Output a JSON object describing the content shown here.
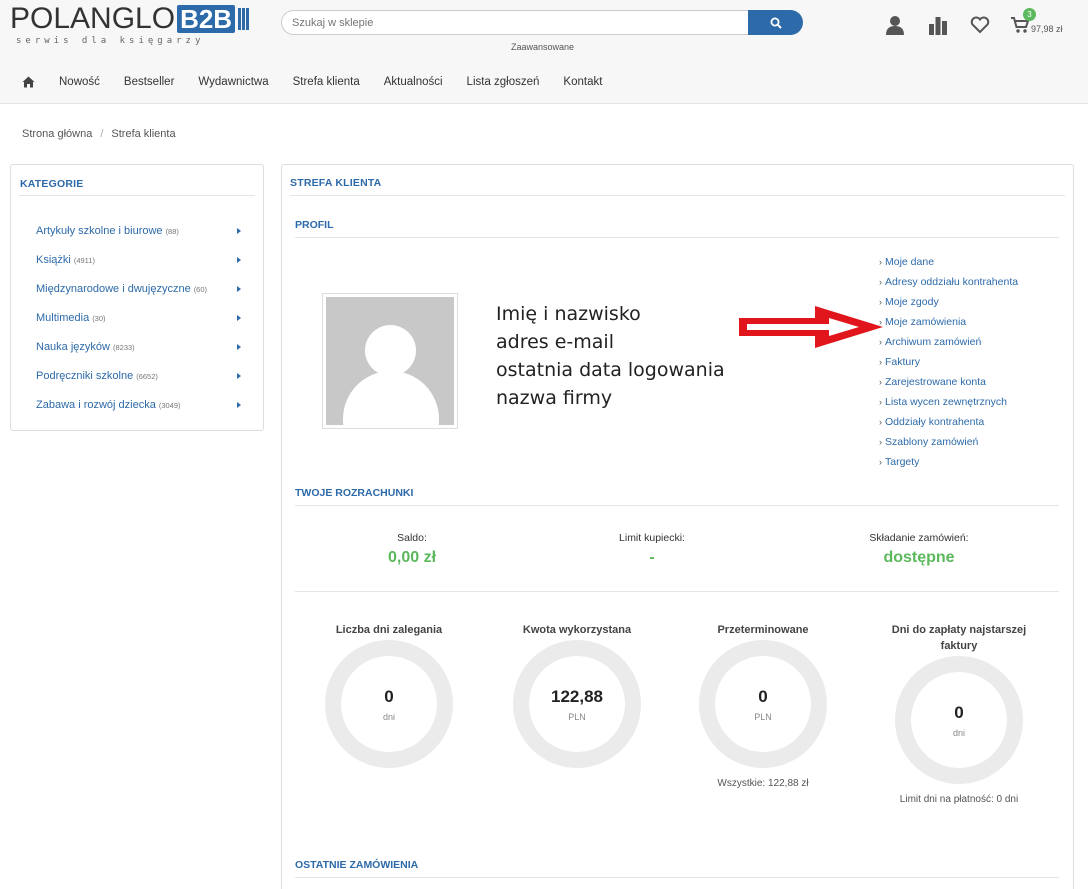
{
  "header": {
    "logo_main": "POLANGLO",
    "logo_b2b": "B2B",
    "logo_sub": "serwis dla księgarzy",
    "search_placeholder": "Szukaj w sklepie",
    "advanced": "Zaawansowane",
    "cart_count": "3",
    "cart_total": "97,98 zł"
  },
  "nav": [
    "Nowość",
    "Bestseller",
    "Wydawnictwa",
    "Strefa klienta",
    "Aktualności",
    "Lista zgłoszeń",
    "Kontakt"
  ],
  "breadcrumb": [
    "Strona główna",
    "Strefa klienta"
  ],
  "categories": {
    "title": "KATEGORIE",
    "items": [
      {
        "label": "Artykuły szkolne i biurowe",
        "count": "(88)"
      },
      {
        "label": "Książki",
        "count": "(4911)"
      },
      {
        "label": "Międzynarodowe i dwujęzyczne",
        "count": "(60)"
      },
      {
        "label": "Multimedia",
        "count": "(30)"
      },
      {
        "label": "Nauka języków",
        "count": "(8233)"
      },
      {
        "label": "Podręczniki szkolne",
        "count": "(6652)"
      },
      {
        "label": "Zabawa i rozwój dziecka",
        "count": "(3049)"
      }
    ]
  },
  "main": {
    "title": "STREFA KLIENTA",
    "profile_title": "PROFIL",
    "profile_lines": [
      "Imię i nazwisko",
      "adres e-mail",
      "ostatnia data logowania",
      "nazwa firmy"
    ],
    "links": [
      "Moje dane",
      "Adresy oddziału kontrahenta",
      "Moje zgody",
      "Moje zamówienia",
      "Archiwum zamówień",
      "Faktury",
      "Zarejestrowane konta",
      "Lista wycen zewnętrznych",
      "Oddziały kontrahenta",
      "Szablony zamówień",
      "Targety"
    ],
    "settlements_title": "TWOJE ROZRACHUNKI",
    "stats": [
      {
        "label": "Saldo:",
        "value": "0,00 zł"
      },
      {
        "label": "Limit kupiecki:",
        "value": "-"
      },
      {
        "label": "Składanie zamówień:",
        "value": "dostępne"
      }
    ],
    "gauges": [
      {
        "title": "Liczba dni zalegania",
        "value": "0",
        "unit": "dni",
        "note": ""
      },
      {
        "title": "Kwota wykorzystana",
        "value": "122,88",
        "unit": "PLN",
        "note": ""
      },
      {
        "title": "Przeterminowane",
        "value": "0",
        "unit": "PLN",
        "note": "Wszystkie: 122,88 zł"
      },
      {
        "title": "Dni do zapłaty najstarszej faktury",
        "value": "0",
        "unit": "dni",
        "note": "Limit dni na płatność: 0 dni"
      }
    ],
    "recent_title": "OSTATNIE ZAMÓWIENIA"
  },
  "colors": {
    "accent": "#2d6aa9",
    "success": "#5cb85c",
    "arrow": "#e0161c"
  }
}
